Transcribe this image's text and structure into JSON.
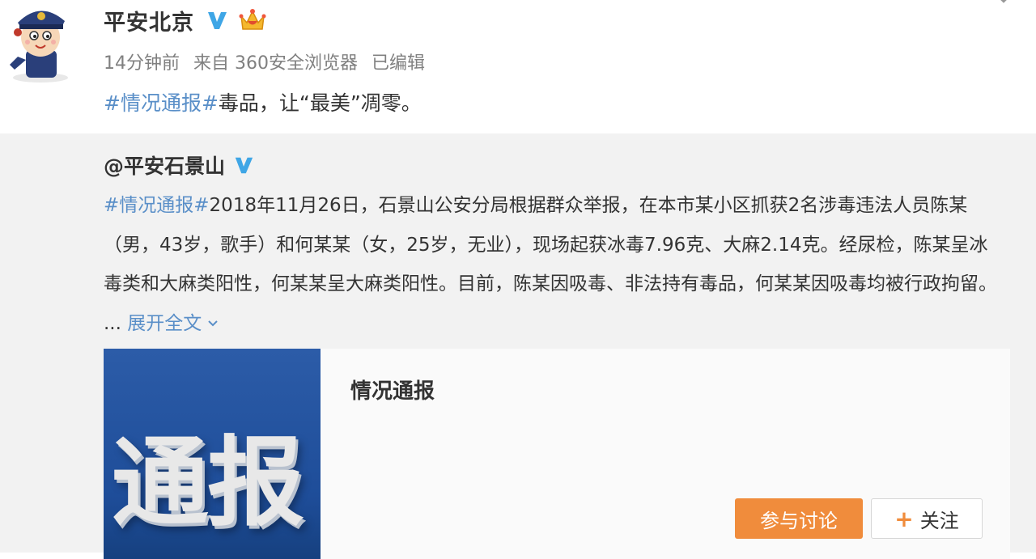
{
  "post": {
    "author": "平安北京",
    "meta": {
      "time": "14分钟前",
      "source": "来自 360安全浏览器",
      "edited": "已编辑"
    },
    "hashtag": "#情况通报#",
    "text": "毒品，让“最美”凋零。"
  },
  "repost": {
    "author": "@平安石景山",
    "hashtag": "#情况通报#",
    "body": "2018年11月26日，石景山公安分局根据群众举报，在本市某小区抓获2名涉毒违法人员陈某（男，43岁，歌手）和何某某（女，25岁，无业），现场起获冰毒7.96克、大麻2.14克。经尿检，陈某呈冰毒类和大麻类阳性，何某某呈大麻类阳性。目前，陈某因吸毒、非法持有毒品，何某某因吸毒均被行政拘留。 ...",
    "expand_label": "展开全文",
    "card": {
      "thumb_text": "通报",
      "title": "情况通报",
      "discuss_label": "参与讨论",
      "follow_label": "关注"
    }
  },
  "colors": {
    "link": "#5a8fc8",
    "accent": "#f08c3c",
    "verified": "#3fa6e6"
  }
}
